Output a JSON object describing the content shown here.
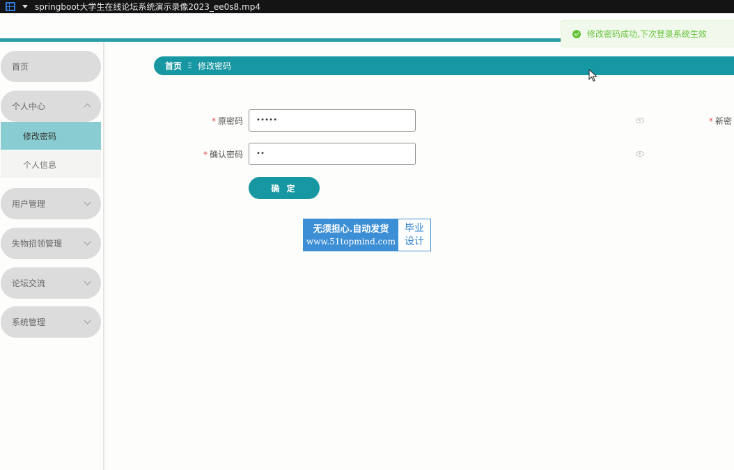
{
  "window": {
    "title": "springboot大学生在线论坛系统演示录像2023_ee0s8.mp4"
  },
  "sidebar": {
    "items": [
      {
        "label": "首页"
      },
      {
        "label": "个人中心",
        "sub": [
          {
            "label": "修改密码",
            "active": true
          },
          {
            "label": "个人信息"
          }
        ]
      },
      {
        "label": "用户管理"
      },
      {
        "label": "失物招领管理"
      },
      {
        "label": "论坛交流"
      },
      {
        "label": "系统管理"
      }
    ]
  },
  "breadcrumb": {
    "home": "首页",
    "separator": "Ξ",
    "current": "修改密码"
  },
  "form": {
    "old_password": {
      "label": "原密码",
      "value": "•••••"
    },
    "new_password": {
      "label": "新密"
    },
    "confirm_password": {
      "label": "确认密码",
      "value": "••"
    },
    "required_mark": "*",
    "submit_label": "确 定"
  },
  "toast": {
    "message": "修改密码成功,下次登录系统生效"
  },
  "watermark": {
    "line1": "无须担心.自动发货",
    "line2": "www.51topmind.com",
    "side": "毕业\n设计"
  },
  "colors": {
    "accent": "#1797a2",
    "active_menu": "#89ccd1",
    "success": "#67c23a"
  }
}
